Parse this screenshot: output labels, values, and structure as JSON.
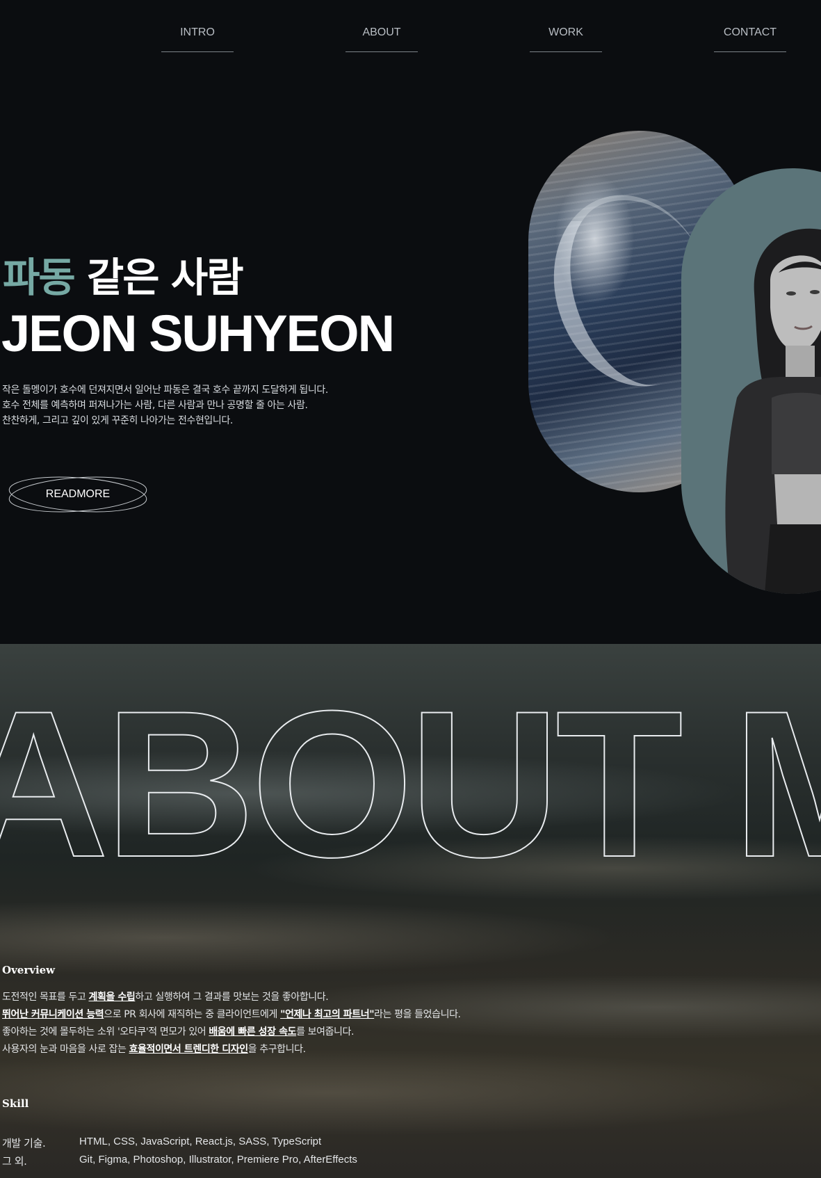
{
  "nav": {
    "items": [
      {
        "label": "INTRO"
      },
      {
        "label": "ABOUT"
      },
      {
        "label": "WORK"
      },
      {
        "label": "CONTACT"
      }
    ]
  },
  "hero": {
    "title_ko_accent": "파동",
    "title_ko_rest": " 같은 사람",
    "title_en": "JEON SUHYEON",
    "description": [
      "작은 돌멩이가 호수에 던져지면서 일어난 파동은 결국 호수 끝까지 도달하게 됩니다.",
      "호수 전체를 예측하며 퍼져나가는 사람, 다른 사람과 만나 공명할 줄 아는 사람.",
      "찬찬하게, 그리고 깊이 있게 꾸준히 나아가는 전수현입니다."
    ],
    "readmore_label": "READMORE",
    "accent_color": "#76a9a4"
  },
  "about": {
    "big_title": "ABOUT ME",
    "overview_heading": "Overview",
    "overview_lines": [
      [
        {
          "t": "도전적인 목표를 두고 "
        },
        {
          "t": "계획을 수립",
          "b": true
        },
        {
          "t": "하고 실행하여 그 결과를 맛보는 것을 좋아합니다."
        }
      ],
      [
        {
          "t": "뛰어난 커뮤니케이션 능력",
          "b": true
        },
        {
          "t": "으로 PR 회사에 재직하는 중 클라이언트에게 "
        },
        {
          "t": "\"언제나 최고의 파트너\"",
          "b": true
        },
        {
          "t": "라는 평을 들었습니다."
        }
      ],
      [
        {
          "t": "좋아하는 것에 몰두하는 소위 '오타쿠'적 면모가 있어 "
        },
        {
          "t": "배움에 빠른 성장 속도",
          "b": true
        },
        {
          "t": "를 보여줍니다."
        }
      ],
      [
        {
          "t": "사용자의 눈과 마음을 사로 잡는 "
        },
        {
          "t": "효율적이면서 트렌디한 디자인",
          "b": true
        },
        {
          "t": "을 추구합니다."
        }
      ]
    ],
    "skill_heading": "Skill",
    "skills": [
      {
        "key": "개발 기술.",
        "value": "HTML, CSS, JavaScript, React.js, SASS, TypeScript"
      },
      {
        "key": "그 외.",
        "value": "Git, Figma, Photoshop, Illustrator, Premiere Pro, AfterEffects"
      }
    ]
  }
}
